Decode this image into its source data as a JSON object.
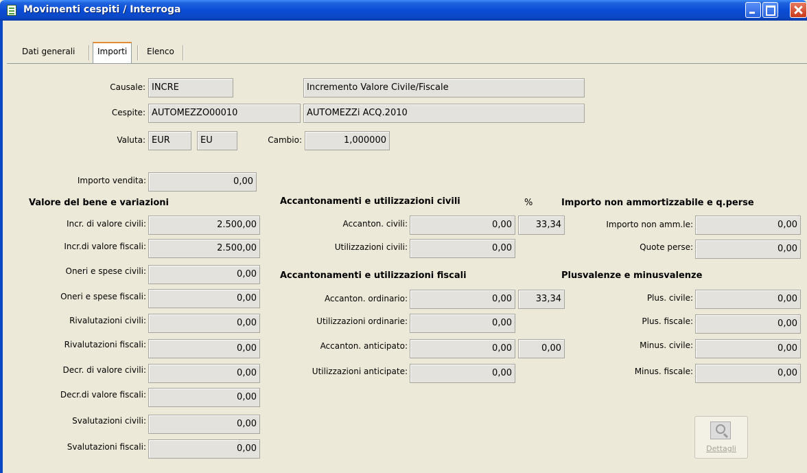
{
  "window": {
    "title": "Movimenti cespiti / Interroga"
  },
  "tabs": [
    {
      "label": "Dati generali"
    },
    {
      "label": "Importi"
    },
    {
      "label": "Elenco"
    }
  ],
  "header": {
    "causale_label": "Causale:",
    "causale_code": "INCRE",
    "causale_desc": "Incremento Valore Civile/Fiscale",
    "cespite_label": "Cespite:",
    "cespite_code": "AUTOMEZZO00010",
    "cespite_desc": "AUTOMEZZi ACQ.2010",
    "valuta_label": "Valuta:",
    "valuta_code": "EUR",
    "valuta_symbol": "EU",
    "cambio_label": "Cambio:",
    "cambio_value": "1,000000"
  },
  "importo_vendita": {
    "label": "Importo vendita:",
    "value": "0,00"
  },
  "valore_bene": {
    "title": "Valore del bene e variazioni",
    "rows": [
      {
        "label": "Incr. di valore civili:",
        "value": "2.500,00"
      },
      {
        "label": "Incr.di valore fiscali:",
        "value": "2.500,00"
      },
      {
        "label": "Oneri e spese civili:",
        "value": "0,00"
      },
      {
        "label": "Oneri e spese fiscali:",
        "value": "0,00"
      },
      {
        "label": "Rivalutazioni civili:",
        "value": "0,00"
      },
      {
        "label": "Rivalutazioni fiscali:",
        "value": "0,00"
      },
      {
        "label": "Decr. di valore civili:",
        "value": "0,00"
      },
      {
        "label": "Decr.di valore fiscali:",
        "value": "0,00"
      },
      {
        "label": "Svalutazioni civili:",
        "value": "0,00"
      },
      {
        "label": "Svalutazioni fiscali:",
        "value": "0,00"
      }
    ]
  },
  "acc_civili": {
    "title": "Accantonamenti e utilizzazioni civili",
    "pct_header": "%",
    "rows": [
      {
        "label": "Accanton. civili:",
        "value": "0,00",
        "pct": "33,34"
      },
      {
        "label": "Utilizzazioni civili:",
        "value": "0,00"
      }
    ]
  },
  "acc_fiscali": {
    "title": "Accantonamenti e utilizzazioni fiscali",
    "rows": [
      {
        "label": "Accanton. ordinario:",
        "value": "0,00",
        "pct": "33,34"
      },
      {
        "label": "Utilizzazioni ordinarie:",
        "value": "0,00"
      },
      {
        "label": "Accanton. anticipato:",
        "value": "0,00",
        "pct": "0,00"
      },
      {
        "label": "Utilizzazioni anticipate:",
        "value": "0,00"
      }
    ]
  },
  "non_amm": {
    "title": "Importo non ammortizzabile e q.perse",
    "rows": [
      {
        "label": "Importo non amm.le:",
        "value": "0,00"
      },
      {
        "label": "Quote perse:",
        "value": "0,00"
      }
    ]
  },
  "plusvalenze": {
    "title": "Plusvalenze e minusvalenze",
    "rows": [
      {
        "label": "Plus. civile:",
        "value": "0,00"
      },
      {
        "label": "Plus. fiscale:",
        "value": "0,00"
      },
      {
        "label": "Minus. civile:",
        "value": "0,00"
      },
      {
        "label": "Minus. fiscale:",
        "value": "0,00"
      }
    ]
  },
  "dettagli_button": {
    "label": "Dettagli",
    "icon": "magnifier-icon"
  }
}
